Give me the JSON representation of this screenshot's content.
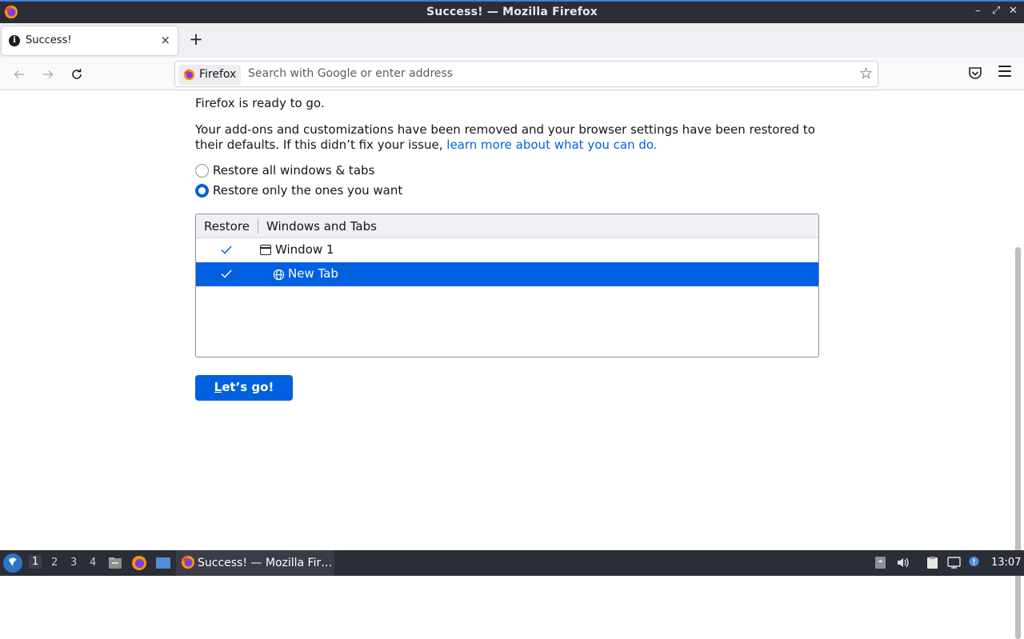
{
  "window": {
    "title": "Success! — Mozilla Firefox",
    "controls": [
      "–",
      "⤢",
      "✕"
    ]
  },
  "tabs": [
    {
      "label": "Success!",
      "icon": "info-icon",
      "close": "×"
    }
  ],
  "toolbar": {
    "new_tab": "+",
    "identity_label": "Firefox",
    "url_placeholder": "Search with Google or enter address"
  },
  "page": {
    "ready": "Firefox is ready to go.",
    "removed_text": "Your add-ons and customizations have been removed and your browser settings have been restored to their defaults. If this didn’t fix your issue,",
    "learn_more": "learn more about what you can do.",
    "options": [
      {
        "label": "Restore all windows & tabs",
        "selected": false
      },
      {
        "label": "Restore only the ones you want",
        "selected": true
      }
    ],
    "tree_headers": [
      "Restore",
      "Windows and Tabs"
    ],
    "tree_rows": [
      {
        "label": "Window 1",
        "checked": true,
        "selected": false,
        "icon": "window-icon"
      },
      {
        "label": "New Tab",
        "checked": true,
        "selected": true,
        "icon": "globe-icon"
      }
    ],
    "button_accel": "L",
    "button_rest": "et’s go!"
  },
  "taskbar": {
    "workspaces": [
      "1",
      "2",
      "3",
      "4"
    ],
    "active_workspace": "1",
    "task_label": "Success! — Mozilla Fir…",
    "clock": "13:07"
  },
  "colors": {
    "accent": "#0060df",
    "titlebar": "#2b2e37",
    "tab_strip": "#f0f0f4"
  }
}
